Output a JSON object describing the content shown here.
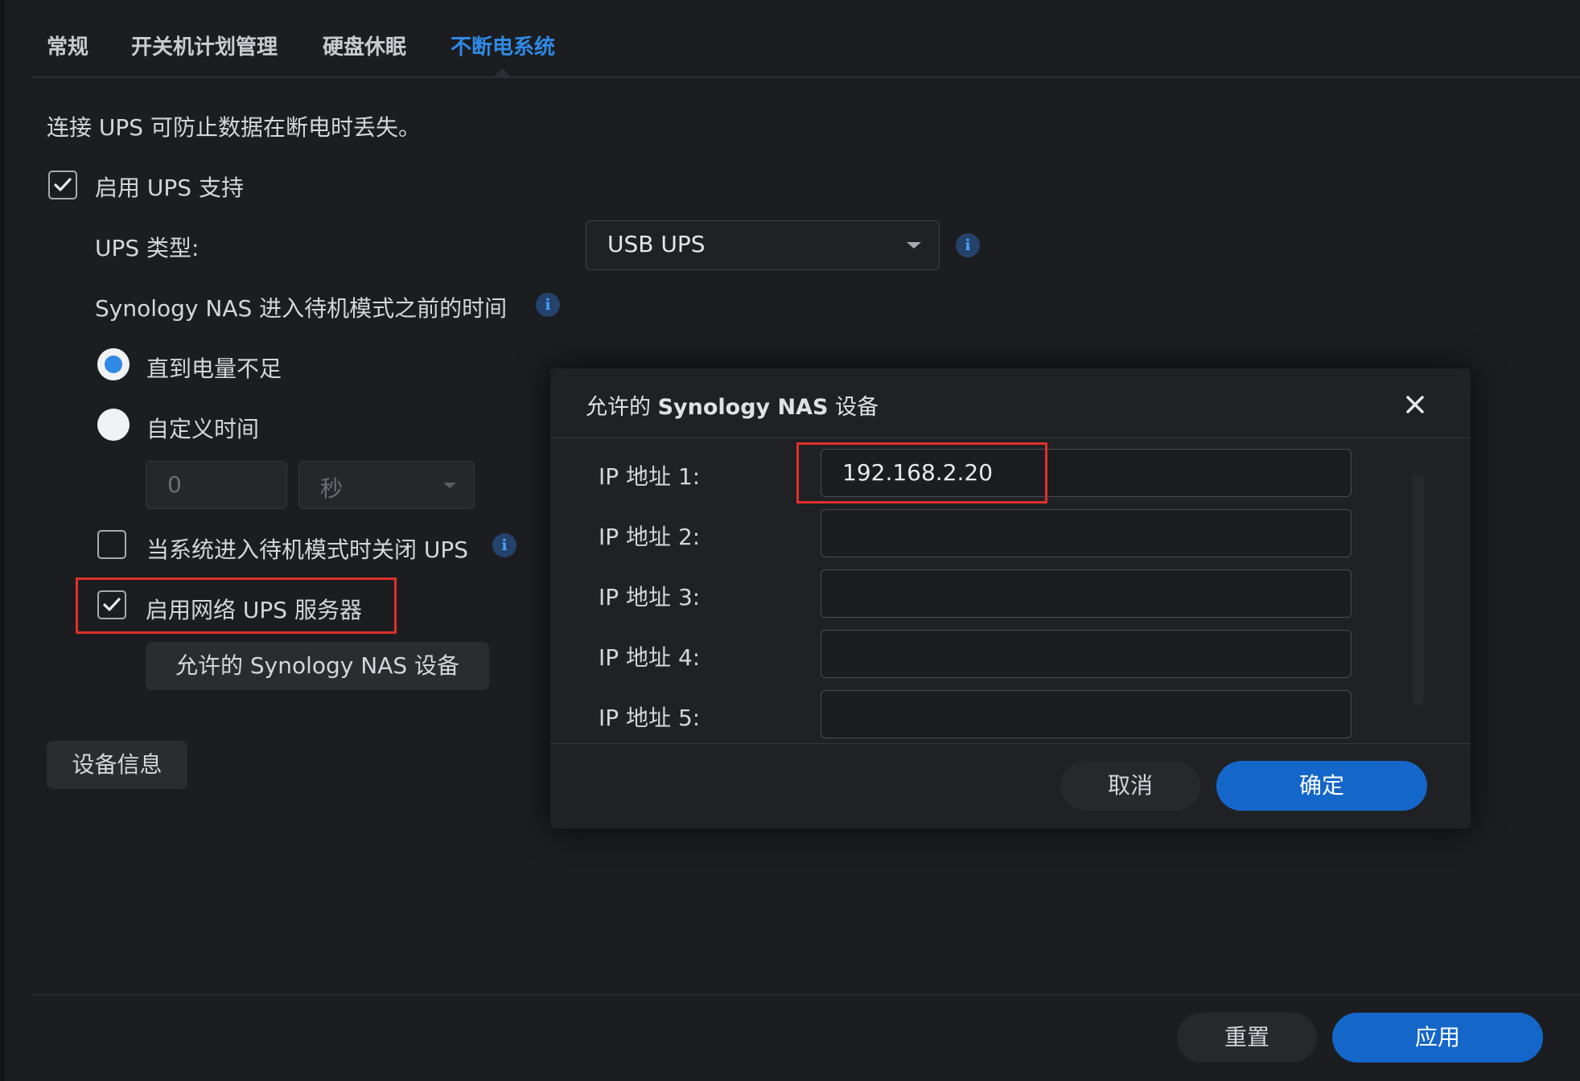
{
  "tabs": [
    {
      "label": "常规",
      "active": false
    },
    {
      "label": "开关机计划管理",
      "active": false
    },
    {
      "label": "硬盘休眠",
      "active": false
    },
    {
      "label": "不断电系统",
      "active": true
    }
  ],
  "ups": {
    "description": "连接 UPS 可防止数据在断电时丢失。",
    "enable_label": "启用 UPS 支持",
    "enable_checked": true,
    "type_label": "UPS 类型:",
    "type_value": "USB UPS",
    "standby_label": "Synology NAS 进入待机模式之前的时间",
    "radio_until_low": "直到电量不足",
    "radio_until_low_selected": true,
    "radio_custom": "自定义时间",
    "custom_value": "0",
    "custom_unit": "秒",
    "shutdown_label": "当系统进入待机模式时关闭 UPS",
    "shutdown_checked": false,
    "network_label": "启用网络 UPS 服务器",
    "network_checked": true,
    "allowed_button": "允许的 Synology NAS 设备",
    "device_info_button": "设备信息"
  },
  "dialog": {
    "title_prefix": "允许的",
    "title_bold": "Synology NAS",
    "title_suffix": "设备",
    "fields": [
      {
        "label": "IP 地址 1:",
        "value": "192.168.2.20"
      },
      {
        "label": "IP 地址 2:",
        "value": ""
      },
      {
        "label": "IP 地址 3:",
        "value": ""
      },
      {
        "label": "IP 地址 4:",
        "value": ""
      },
      {
        "label": "IP 地址 5:",
        "value": ""
      }
    ],
    "cancel_label": "取消",
    "ok_label": "确定"
  },
  "footer": {
    "reset_label": "重置",
    "apply_label": "应用"
  },
  "colors": {
    "accent": "#1467c9",
    "active_tab": "#2f8ae6",
    "highlight": "#e0302a",
    "background": "#1c1d20"
  },
  "icons": [
    "checkbox-check-icon",
    "dropdown-caret-icon",
    "info-icon",
    "close-icon"
  ]
}
